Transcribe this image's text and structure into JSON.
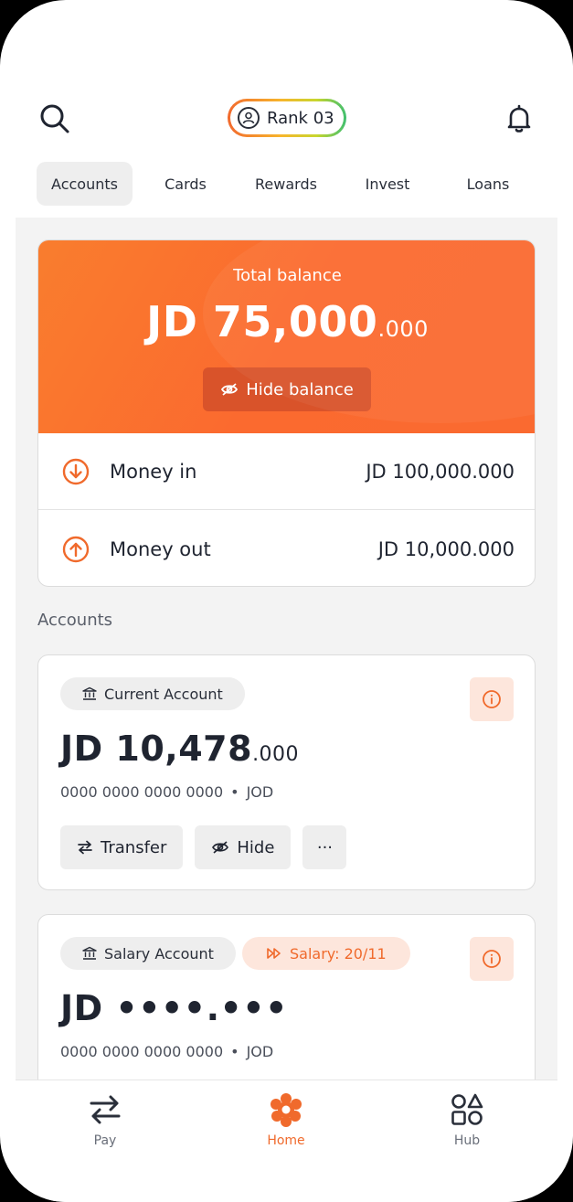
{
  "header": {
    "rank_label": "Rank 03"
  },
  "tabs": [
    {
      "label": "Accounts",
      "active": true
    },
    {
      "label": "Cards",
      "active": false
    },
    {
      "label": "Rewards",
      "active": false
    },
    {
      "label": "Invest",
      "active": false
    },
    {
      "label": "Loans",
      "active": false
    }
  ],
  "balance": {
    "label": "Total balance",
    "amount_main": "JD 75,000",
    "amount_decimal": ".000",
    "hide_label": "Hide balance",
    "money_in_label": "Money in",
    "money_in_value": "JD 100,000.000",
    "money_out_label": "Money out",
    "money_out_value": "JD 10,000.000"
  },
  "accounts_section_title": "Accounts",
  "accounts": [
    {
      "type_label": "Current Account",
      "amount_main": "JD 10,478",
      "amount_decimal": ".000",
      "number": "0000 0000 0000 0000",
      "separator": "•",
      "currency": "JOD",
      "actions": {
        "transfer": "Transfer",
        "hide": "Hide",
        "more": "···"
      }
    },
    {
      "type_label": "Salary Account",
      "salary_badge": "Salary: 20/11",
      "amount_main": "JD ••••",
      "amount_decimal": ".•••",
      "number": "0000 0000 0000 0000",
      "separator": "•",
      "currency": "JOD"
    }
  ],
  "bottom_nav": {
    "pay": "Pay",
    "home": "Home",
    "hub": "Hub"
  },
  "colors": {
    "brand_orange": "#fb6a2f",
    "accent_soft": "#fde6dc"
  }
}
